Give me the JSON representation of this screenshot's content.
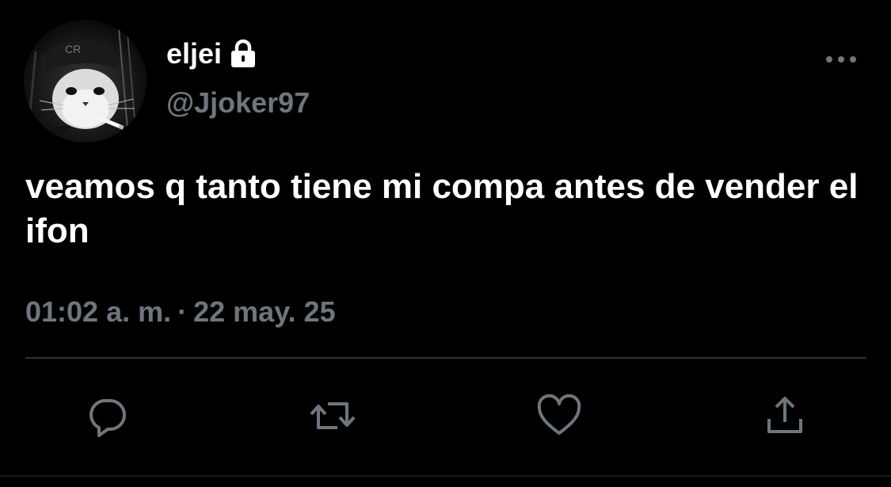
{
  "tweet": {
    "display_name": "eljei",
    "handle": "@Jjoker97",
    "text": "veamos q tanto tiene mi compa antes de vender el ifon",
    "time": "01:02 a. m.",
    "separator": "·",
    "date": "22 may. 25"
  },
  "icons": {
    "avatar": "profile-picture",
    "protected": "lock-icon",
    "more": "more-options-icon",
    "reply": "reply-icon",
    "retweet": "retweet-icon",
    "like": "heart-icon",
    "share": "share-icon"
  },
  "colors": {
    "background": "#000000",
    "primary_text": "#ffffff",
    "secondary_text": "#6e767d",
    "divider": "#2f3336"
  }
}
